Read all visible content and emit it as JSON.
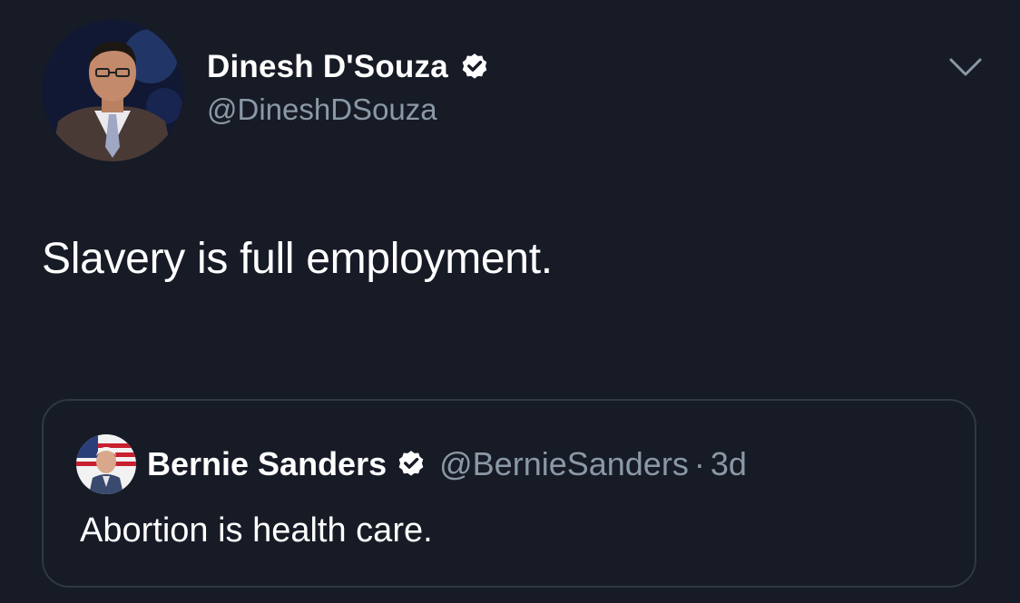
{
  "tweet": {
    "author": {
      "display_name": "Dinesh D'Souza",
      "handle": "@DineshDSouza",
      "verified": true,
      "avatar_icon": "profile-photo"
    },
    "text": "Slavery is full employment.",
    "menu_icon": "chevron-down-icon"
  },
  "quoted_tweet": {
    "author": {
      "display_name": "Bernie Sanders",
      "handle": "@BernieSanders",
      "verified": true,
      "avatar_icon": "profile-photo"
    },
    "separator": "·",
    "time": "3d",
    "text": "Abortion is health care."
  },
  "colors": {
    "background": "#161b26",
    "primary_text": "#ffffff",
    "secondary_text": "#8b98a5",
    "card_border": "#2f3846"
  }
}
